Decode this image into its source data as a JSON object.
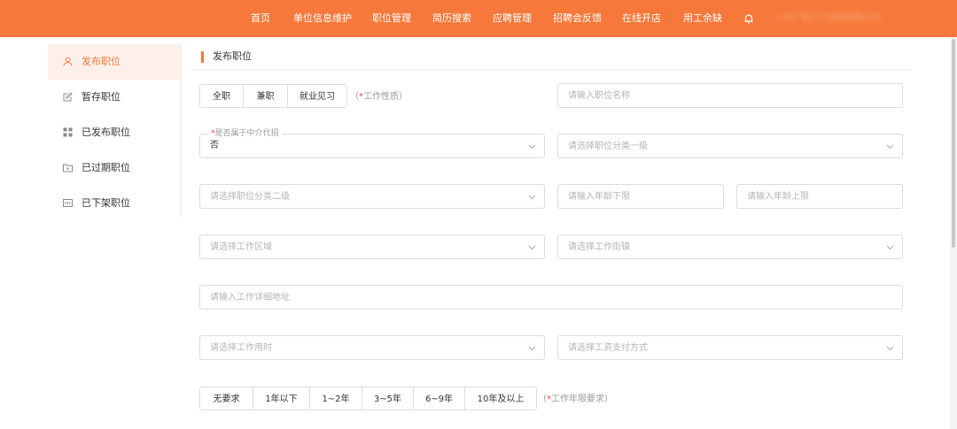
{
  "header": {
    "nav": [
      "首页",
      "单位信息维护",
      "职位管理",
      "简历搜索",
      "应聘管理",
      "招聘会反馈",
      "在线开店",
      "用工余缺"
    ],
    "bell_icon": "bell-icon",
    "username": "上海广慧人力资源有限公司",
    "bg_color": "#f6783a"
  },
  "sidebar": {
    "items": [
      {
        "label": "发布职位",
        "icon": "user-icon",
        "active": true
      },
      {
        "label": "暂存职位",
        "icon": "edit-icon",
        "active": false
      },
      {
        "label": "已发布职位",
        "icon": "grid-icon",
        "active": false
      },
      {
        "label": "已过期职位",
        "icon": "folder-play-icon",
        "active": false
      },
      {
        "label": "已下架职位",
        "icon": "box-icon",
        "active": false
      }
    ]
  },
  "section": {
    "title": "发布职位"
  },
  "form": {
    "job_type": {
      "options": [
        "全职",
        "兼职",
        "就业见习"
      ],
      "hint_prefix": "（",
      "hint_star": "*",
      "hint_text": "工作性质）"
    },
    "job_name": {
      "placeholder": "请输入职位名称"
    },
    "agency": {
      "label_star": "*",
      "label": "是否属于中介代招",
      "value": "否"
    },
    "category1": {
      "placeholder": "请选择职位分类一级"
    },
    "category2": {
      "placeholder": "请选择职位分类二级"
    },
    "age_min": {
      "placeholder": "请输入年龄下限"
    },
    "age_max": {
      "placeholder": "请输入年龄上限"
    },
    "work_area": {
      "placeholder": "请选择工作区域"
    },
    "work_street": {
      "placeholder": "请选择工作街镇"
    },
    "address": {
      "placeholder": "请输入工作详细地址"
    },
    "work_hours": {
      "placeholder": "请选择工作用时"
    },
    "pay_method": {
      "placeholder": "请选择工资支付方式"
    },
    "experience": {
      "options": [
        "无要求",
        "1年以下",
        "1~2年",
        "3~5年",
        "6~9年",
        "10年及以上"
      ],
      "hint_prefix": "（",
      "hint_star": "*",
      "hint_text": "工作年限要求）"
    }
  }
}
